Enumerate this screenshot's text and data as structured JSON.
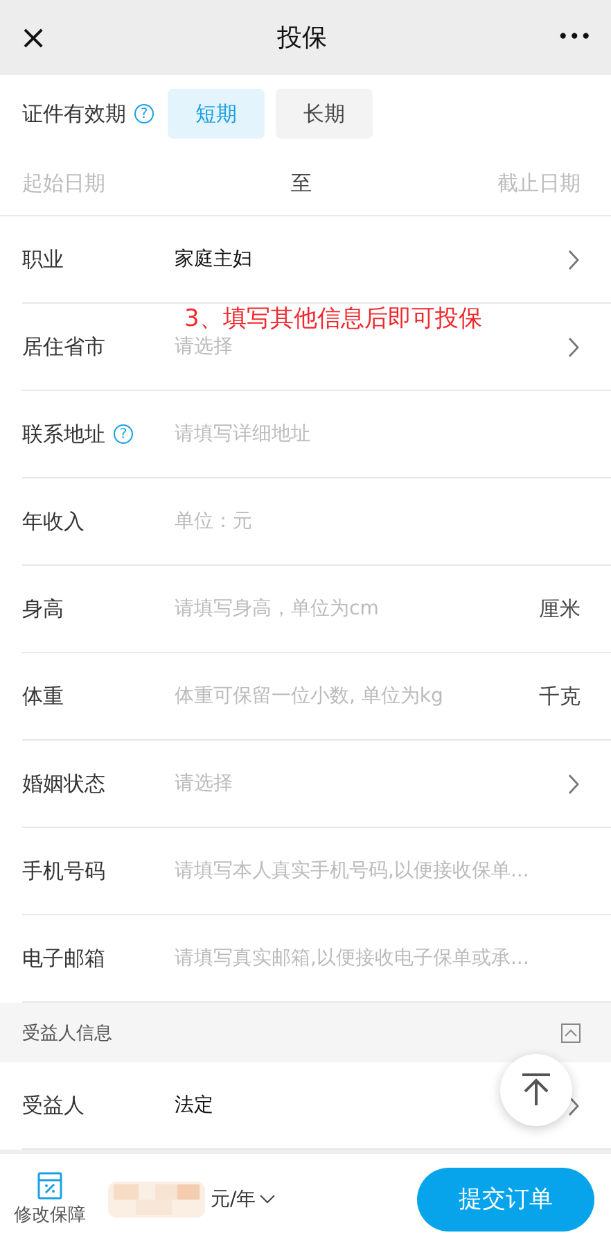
{
  "header": {
    "close": "×",
    "title": "投保",
    "more": "•••"
  },
  "validity": {
    "label": "证件有效期",
    "help": "?",
    "options": [
      {
        "label": "短期",
        "selected": true
      },
      {
        "label": "长期",
        "selected": false
      }
    ]
  },
  "dates": {
    "start": "起始日期",
    "to": "至",
    "end": "截止日期"
  },
  "annotation": "3、填写其他信息后即可投保",
  "fields": [
    {
      "kind": "select",
      "label": "职业",
      "value": "家庭主妇"
    },
    {
      "kind": "select",
      "label": "居住省市",
      "placeholder": "请选择"
    },
    {
      "kind": "input",
      "label": "联系地址",
      "help": "?",
      "placeholder": "请填写详细地址"
    },
    {
      "kind": "input",
      "label": "年收入",
      "placeholder": "单位：元"
    },
    {
      "kind": "input",
      "label": "身高",
      "placeholder": "请填写身高，单位为cm",
      "unit": "厘米"
    },
    {
      "kind": "input",
      "label": "体重",
      "placeholder": "体重可保留一位小数, 单位为kg",
      "unit": "千克"
    },
    {
      "kind": "select",
      "label": "婚姻状态",
      "placeholder": "请选择"
    },
    {
      "kind": "input",
      "label": "手机号码",
      "placeholder": "请填写本人真实手机号码,以便接收保单..."
    },
    {
      "kind": "input",
      "label": "电子邮箱",
      "placeholder": "请填写真实邮箱,以便接收电子保单或承..."
    }
  ],
  "section": {
    "title": "受益人信息",
    "expanded": true
  },
  "beneficiary": {
    "kind": "select",
    "label": "受益人",
    "value": "法定"
  },
  "footer": {
    "modify": "修改保障",
    "price_unit": "元/年",
    "submit": "提交订单"
  }
}
